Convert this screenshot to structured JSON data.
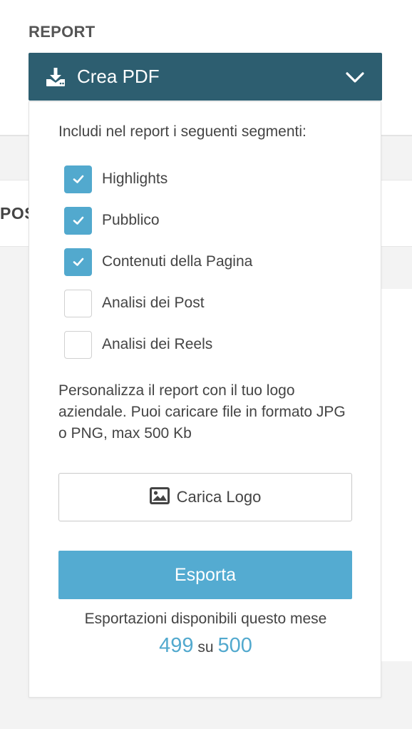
{
  "background": {
    "partial_heading": "POS"
  },
  "report": {
    "label": "REPORT",
    "dropdown": {
      "title": "Crea PDF",
      "icon": "download-icon",
      "toggle_icon": "chevron-down-icon"
    }
  },
  "panel": {
    "intro": "Includi nel report i seguenti segmenti:",
    "segments": [
      {
        "label": "Highlights",
        "checked": true
      },
      {
        "label": "Pubblico",
        "checked": true
      },
      {
        "label": "Contenuti della Pagina",
        "checked": true
      },
      {
        "label": "Analisi dei Post",
        "checked": false
      },
      {
        "label": "Analisi dei Reels",
        "checked": false
      }
    ],
    "logo_description": "Personalizza il report con il tuo logo aziendale. Puoi caricare file in formato JPG o PNG, max 500 Kb",
    "upload_button": {
      "label": "Carica Logo",
      "icon": "image-icon"
    },
    "export_button": {
      "label": "Esporta"
    },
    "exports": {
      "caption": "Esportazioni disponibili questo mese",
      "available": "499",
      "separator": "su",
      "total": "500"
    }
  },
  "colors": {
    "header_bg": "#2d5e70",
    "accent": "#52a9ce",
    "export_bg": "#54abd1"
  }
}
